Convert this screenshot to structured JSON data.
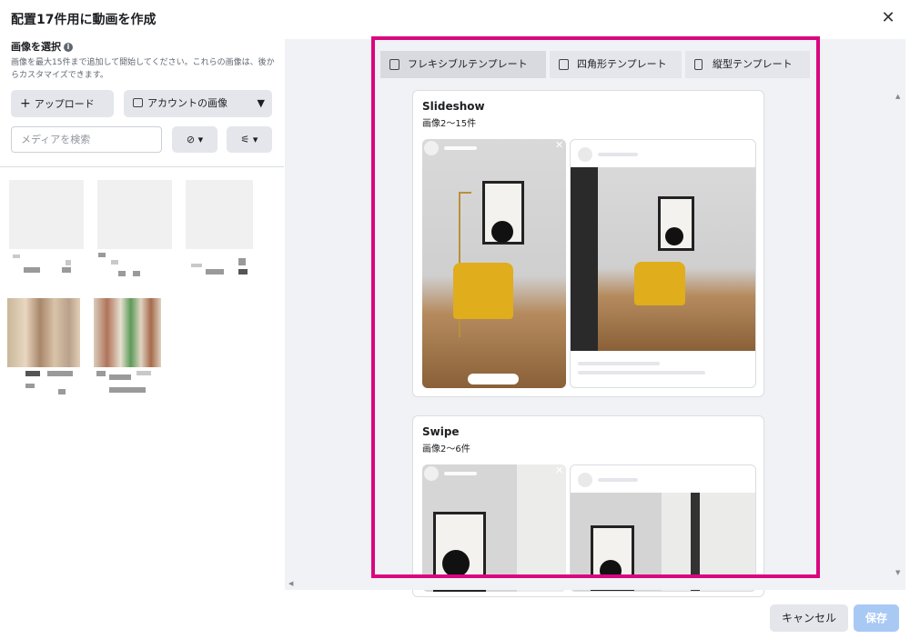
{
  "dialog": {
    "title": "配置17件用に動画を作成",
    "close_icon": "close-icon"
  },
  "left": {
    "select_label": "画像を選択",
    "info_glyph": "i",
    "select_desc": "画像を最大15件まで追加して開始してください。これらの画像は、後からカスタマイズできます。",
    "upload_label": "アップロード",
    "upload_glyph": "+",
    "account_images_label": "アカウントの画像",
    "caret_glyph": "▼",
    "search_placeholder": "メディアを検索",
    "filter_glyph": "⊘ ▾",
    "sliders_glyph": "⚟ ▾"
  },
  "tabs": [
    {
      "label": "フレキシブルテンプレート",
      "active": true
    },
    {
      "label": "四角形テンプレート",
      "active": false
    },
    {
      "label": "縦型テンプレート",
      "active": false
    }
  ],
  "templates": [
    {
      "title": "Slideshow",
      "subtitle": "画像2〜15件"
    },
    {
      "title": "Swipe",
      "subtitle": "画像2〜6件"
    }
  ],
  "footer": {
    "cancel_label": "キャンセル",
    "save_label": "保存"
  },
  "colors": {
    "highlight": "#d9067f",
    "save_disabled": "#a9c9f5"
  }
}
